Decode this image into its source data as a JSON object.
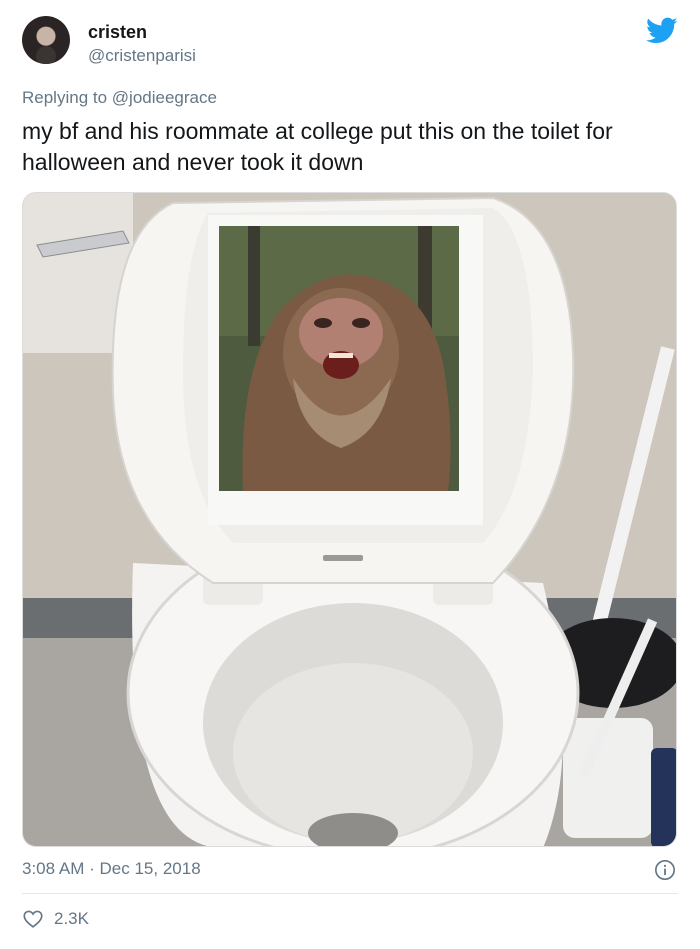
{
  "author": {
    "name": "cristen",
    "handle": "@cristenparisi"
  },
  "reply": {
    "prefix": "Replying to",
    "mention": "@jodieegrace"
  },
  "tweet": {
    "text": "my bf and his roommate at college put this on the toilet for halloween and never took it down"
  },
  "meta": {
    "time": "3:08 AM",
    "separator": "·",
    "date": "Dec 15, 2018"
  },
  "engagement": {
    "likes": "2.3K"
  },
  "colors": {
    "twitter_blue": "#1da1f2",
    "muted_text": "#657786"
  },
  "icons": {
    "brand": "twitter-bird-icon",
    "info": "info-icon",
    "like": "heart-icon"
  }
}
